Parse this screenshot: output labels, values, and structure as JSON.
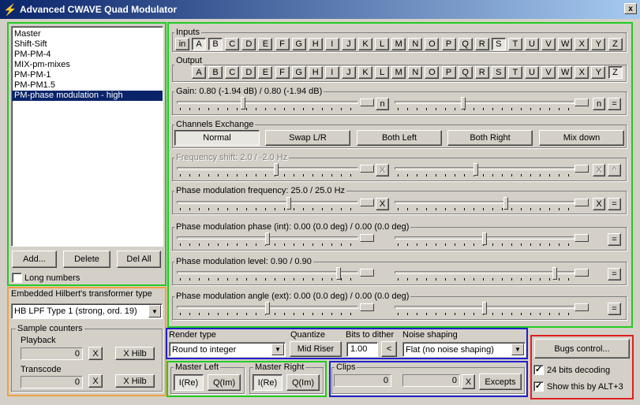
{
  "window": {
    "title": "Advanced CWAVE Quad Modulator",
    "close_label": "x"
  },
  "presets": {
    "items": [
      "Master",
      "Shift-Sift",
      "PM-PM-4",
      "MIX-pm-mixes",
      "PM-PM-1",
      "PM-PM1.5",
      "PM-phase modulation - high"
    ],
    "selected_index": 6,
    "add_label": "Add...",
    "delete_label": "Delete",
    "delall_label": "Del All",
    "long_numbers_label": "Long numbers",
    "long_numbers_checked": false
  },
  "hilbert": {
    "label": "Embedded Hilbert's transformer type",
    "value": "HB LPF Type 1 (strong, ord. 19)"
  },
  "counters": {
    "group_label": "Sample counters",
    "playback_label": "Playback",
    "playback_value": "0",
    "transcode_label": "Transcode",
    "transcode_value": "0",
    "x_label": "X",
    "xhilb_label": "X Hilb"
  },
  "inputs": {
    "label": "Inputs",
    "in_label": "in",
    "letters": [
      "A",
      "B",
      "C",
      "D",
      "E",
      "F",
      "G",
      "H",
      "I",
      "J",
      "K",
      "L",
      "M",
      "N",
      "O",
      "P",
      "Q",
      "R",
      "S",
      "T",
      "U",
      "V",
      "W",
      "X",
      "Y",
      "Z"
    ],
    "pressed": [
      "A",
      "B",
      "S"
    ]
  },
  "output": {
    "label": "Output",
    "pressed": [
      "Z"
    ]
  },
  "gain": {
    "label": "Gain: 0.80 (-1.94 dB) / 0.80 (-1.94 dB)",
    "left_level": 0.36,
    "right_level": 0.38,
    "btn_left": "n",
    "btn_right": "n",
    "eq": "="
  },
  "channels": {
    "label": "Channels Exchange",
    "buttons": [
      "Normal",
      "Swap L/R",
      "Both Left",
      "Both Right",
      "Mix down"
    ],
    "selected": "Normal"
  },
  "freq_shift": {
    "label": "Frequency shift: 2.0 / -2.0 Hz",
    "left_level": 0.55,
    "right_level": 0.45,
    "x": "X",
    "up": "^"
  },
  "pm_freq": {
    "label": "Phase modulation frequency: 25.0 / 25.0 Hz",
    "left_level": 0.62,
    "right_level": 0.62,
    "x": "X",
    "eq": "="
  },
  "pm_phase": {
    "label": "Phase modulation phase (int): 0.00 (0.0 deg) / 0.00 (0.0 deg)",
    "left_level": 0.5,
    "right_level": 0.5,
    "eq": "="
  },
  "pm_level": {
    "label": "Phase modulation level: 0.90 / 0.90",
    "left_level": 0.9,
    "right_level": 0.9,
    "eq": "="
  },
  "pm_angle": {
    "label": "Phase modulation angle (ext): 0.00 (0.0 deg) / 0.00 (0.0 deg)",
    "left_level": 0.5,
    "right_level": 0.5,
    "eq": "="
  },
  "render": {
    "label": "Render type",
    "value": "Round to integer"
  },
  "quantize": {
    "label": "Quantize",
    "button": "Mid Riser"
  },
  "dither": {
    "label": "Bits to dither",
    "value": "1.00",
    "button": "<"
  },
  "noise": {
    "label": "Noise shaping",
    "value": "Flat (no noise shaping)"
  },
  "master_left": {
    "label": "Master Left",
    "re": "I(Re)",
    "im": "Q(Im)"
  },
  "master_right": {
    "label": "Master Right",
    "re": "I(Re)",
    "im": "Q(Im)"
  },
  "clips": {
    "label": "Clips",
    "left": "0",
    "right": "0",
    "x": "X",
    "excepts": "Excepts"
  },
  "bugs": {
    "button": "Bugs control...",
    "bits24_label": "24 bits decoding",
    "bits24_checked": true,
    "show_label": "Show this by ALT+3",
    "show_checked": true
  },
  "colors": {
    "title_start": "#0a246a",
    "title_end": "#a6caf0",
    "highlight_green": "#22cc22",
    "highlight_orange": "#f0a040",
    "highlight_blue": "#2020c8",
    "highlight_red": "#e02020",
    "selection": "#0a246a"
  }
}
